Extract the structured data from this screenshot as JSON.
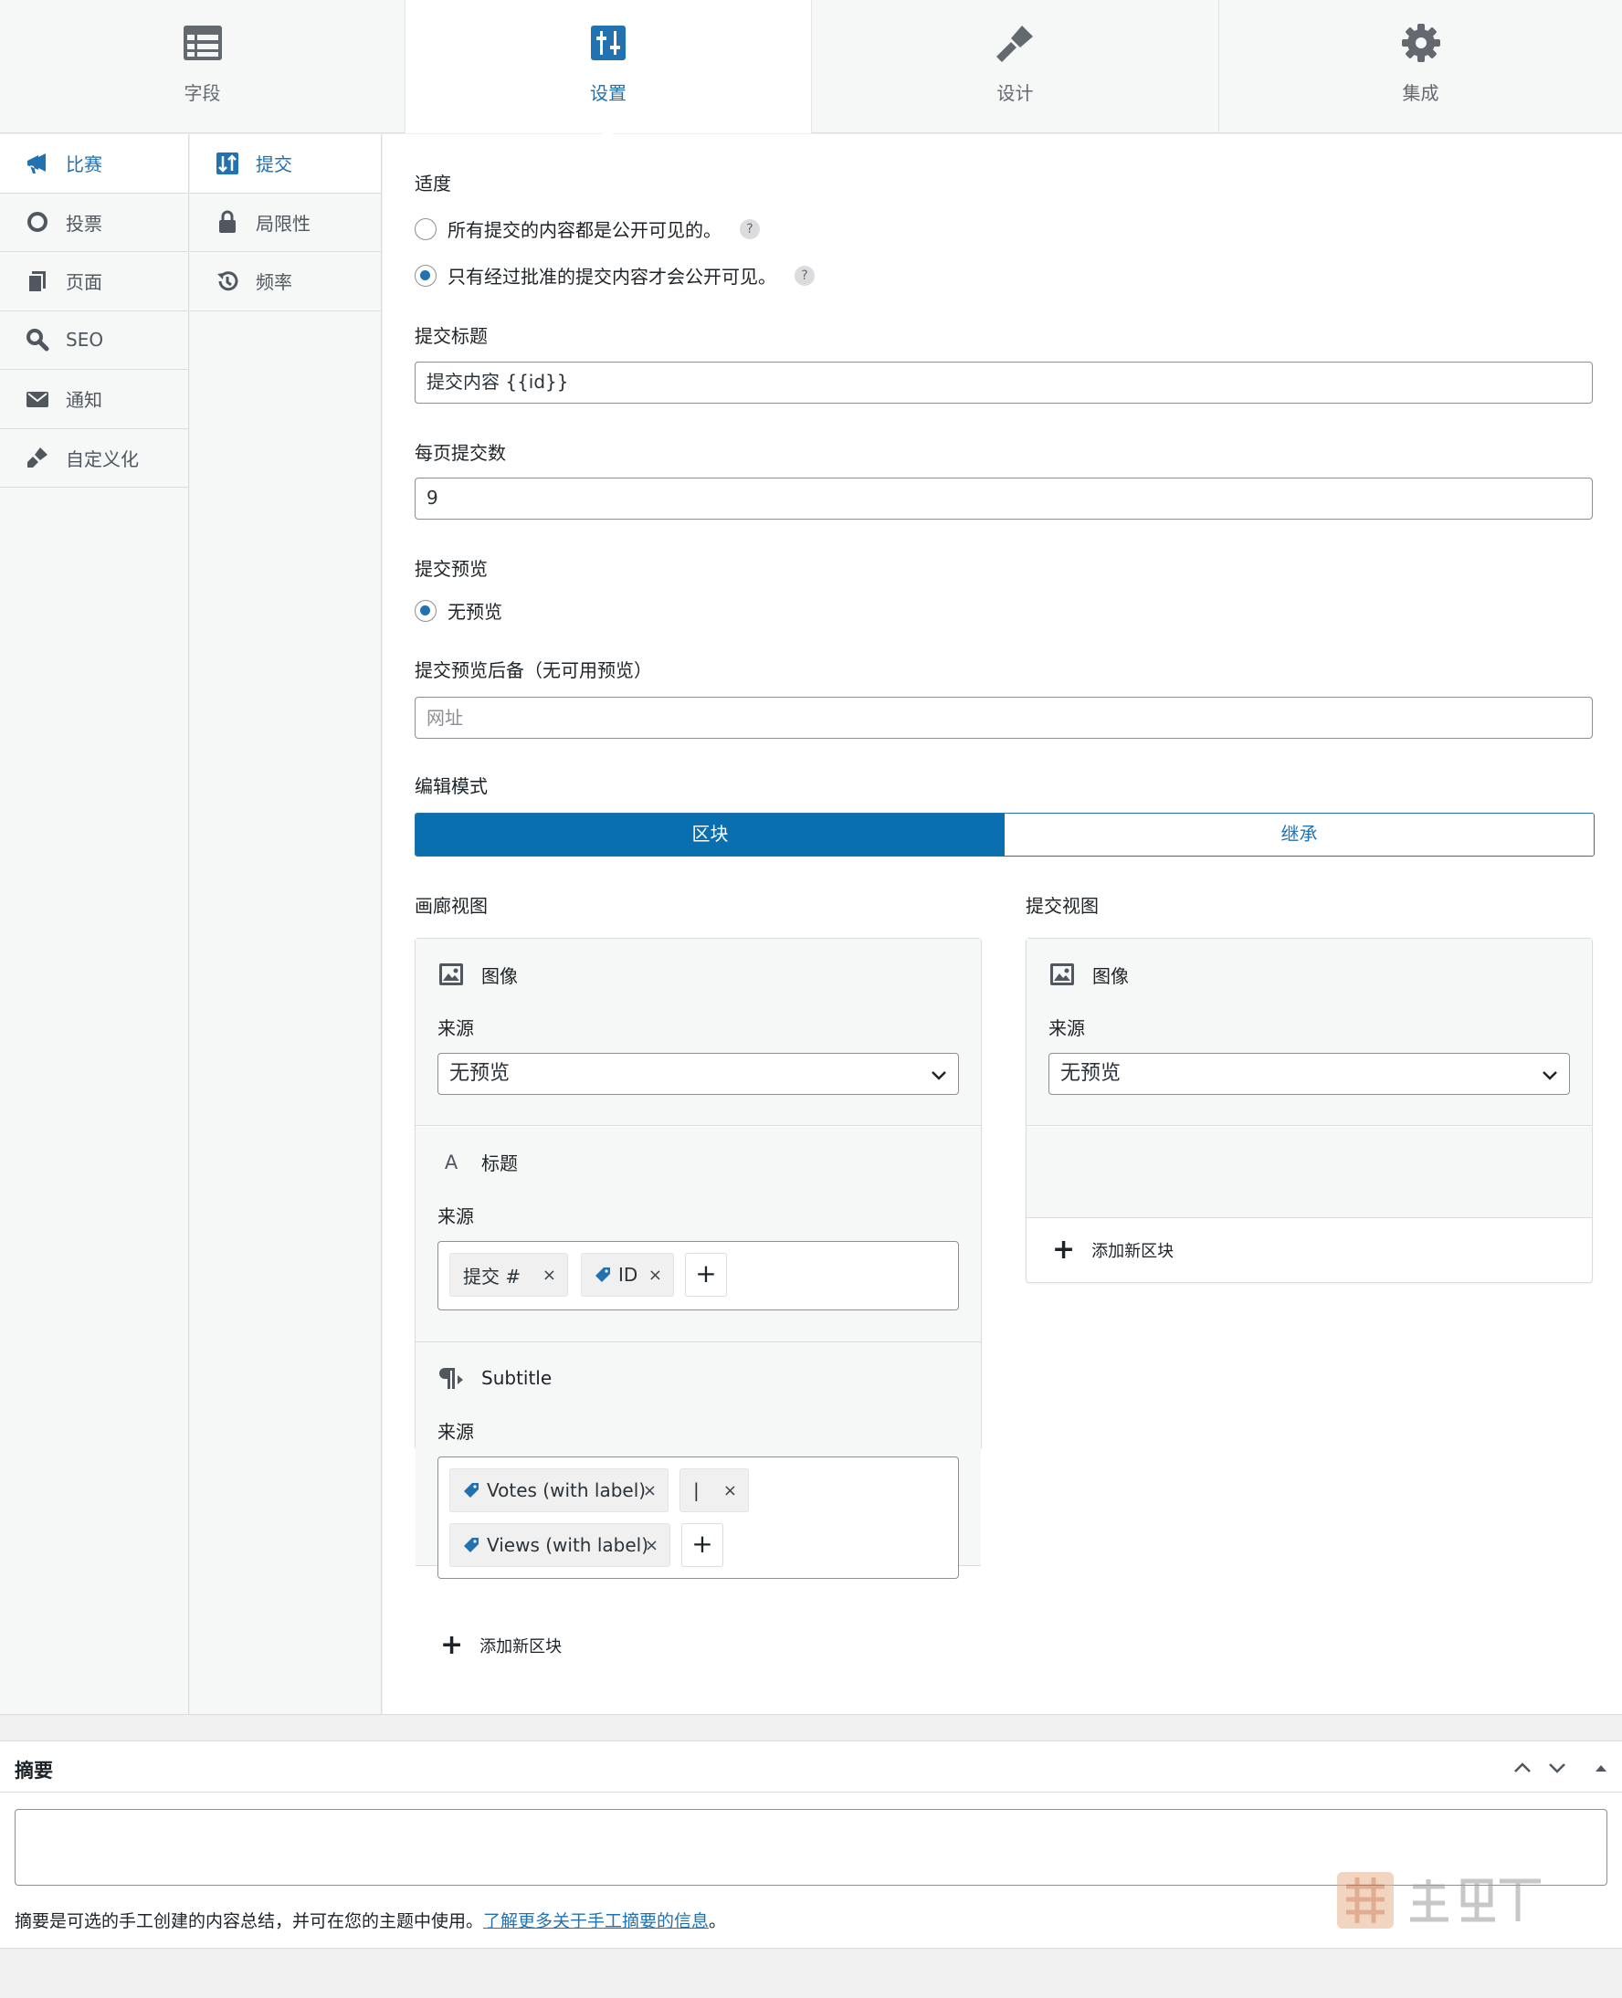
{
  "top_tabs": [
    {
      "label": "字段",
      "icon": "fields-table-icon"
    },
    {
      "label": "设置",
      "icon": "settings-sliders-icon"
    },
    {
      "label": "设计",
      "icon": "design-brush-icon"
    },
    {
      "label": "集成",
      "icon": "gear-icon"
    }
  ],
  "left_nav": [
    {
      "label": "比赛",
      "icon": "megaphone-icon"
    },
    {
      "label": "投票",
      "icon": "circle-icon"
    },
    {
      "label": "页面",
      "icon": "pages-icon"
    },
    {
      "label": "SEO",
      "icon": "search-icon"
    },
    {
      "label": "通知",
      "icon": "envelope-icon"
    },
    {
      "label": "自定义化",
      "icon": "customize-brush-icon"
    }
  ],
  "sub_nav": [
    {
      "label": "提交",
      "icon": "sort-icon"
    },
    {
      "label": "局限性",
      "icon": "lock-icon"
    },
    {
      "label": "频率",
      "icon": "history-icon"
    }
  ],
  "form": {
    "moderation": {
      "label": "适度",
      "options": [
        "所有提交的内容都是公开可见的。",
        "只有经过批准的提交内容才会公开可见。"
      ],
      "selected_index": 1,
      "help": "?"
    },
    "submission_title": {
      "label": "提交标题",
      "value": "提交内容 {{id}}"
    },
    "per_page": {
      "label": "每页提交数",
      "value": "9"
    },
    "preview": {
      "label": "提交预览",
      "option": "无预览"
    },
    "preview_fallback": {
      "label": "提交预览后备（无可用预览）",
      "placeholder": "网址"
    },
    "edit_mode": {
      "label": "编辑模式",
      "options": [
        "区块",
        "继承"
      ],
      "selected": "区块"
    }
  },
  "gallery_view": {
    "label": "画廊视图",
    "image_block": {
      "title": "图像",
      "source_label": "来源",
      "source_value": "无预览"
    },
    "title_block": {
      "icon_text": "A",
      "title": "标题",
      "source_label": "来源",
      "tokens": [
        "提交 #",
        "ID"
      ],
      "remove": "×",
      "add": "+"
    },
    "subtitle_block": {
      "title": "Subtitle",
      "source_label": "来源",
      "tokens": [
        "Votes (with label)",
        "|",
        "Views (with label)"
      ],
      "remove": "×",
      "add": "+"
    },
    "add_block": "添加新区块"
  },
  "submission_view": {
    "label": "提交视图",
    "image_block": {
      "title": "图像",
      "source_label": "来源",
      "source_value": "无预览"
    },
    "add_block": "添加新区块"
  },
  "excerpt": {
    "title": "摘要",
    "description": "摘要是可选的手工创建的内容总结，并可在您的主题中使用。",
    "link": "了解更多关于手工摘要的信息",
    "period": "。"
  },
  "colors": {
    "accent": "#2271b1",
    "segment_active": "#0a6fae",
    "border": "#dcdcde"
  }
}
